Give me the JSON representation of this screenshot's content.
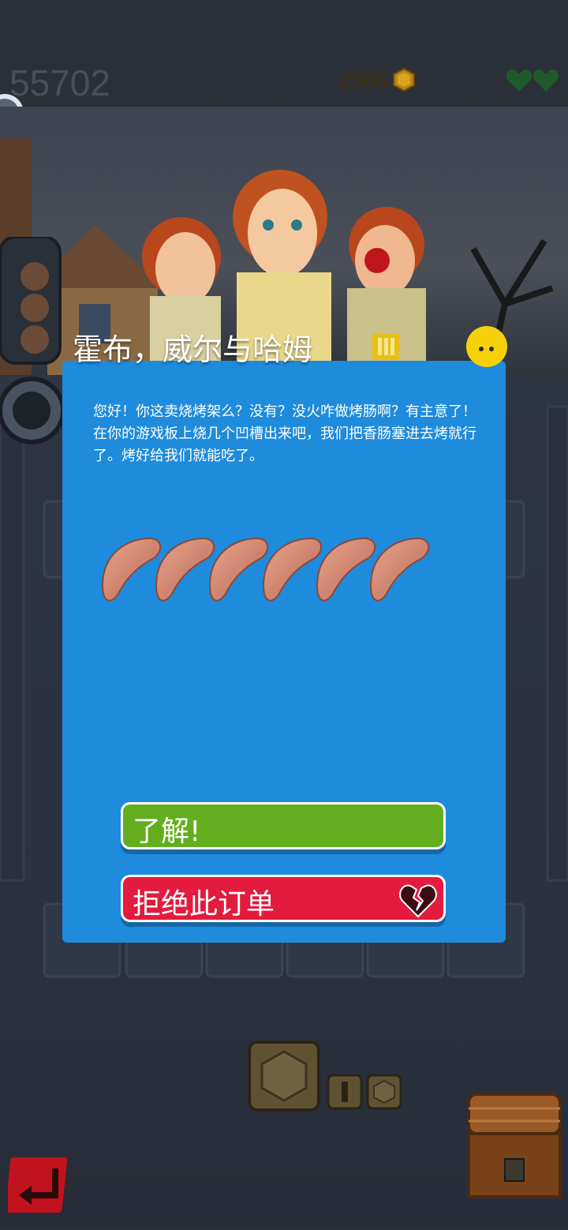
{
  "hud": {
    "score": "55702",
    "coins": "2306"
  },
  "dialog": {
    "customer_name": "霍布，威尔与哈姆",
    "message": "您好！你这卖烧烤架么？没有？没火咋做烤肠啊？有主意了！在你的游戏板上烧几个凹槽出来吧，我们把香肠塞进去烤就行了。烤好给我们就能吃了。",
    "order_items": [
      "sausage-icon",
      "sausage-icon",
      "sausage-icon",
      "sausage-icon",
      "sausage-icon",
      "sausage-icon"
    ],
    "accept_label": "了解!",
    "reject_label": "拒绝此订单"
  },
  "colors": {
    "dialog_bg": "#1e8bdc",
    "accept": "#63ae1e",
    "reject": "#e31b3e"
  }
}
